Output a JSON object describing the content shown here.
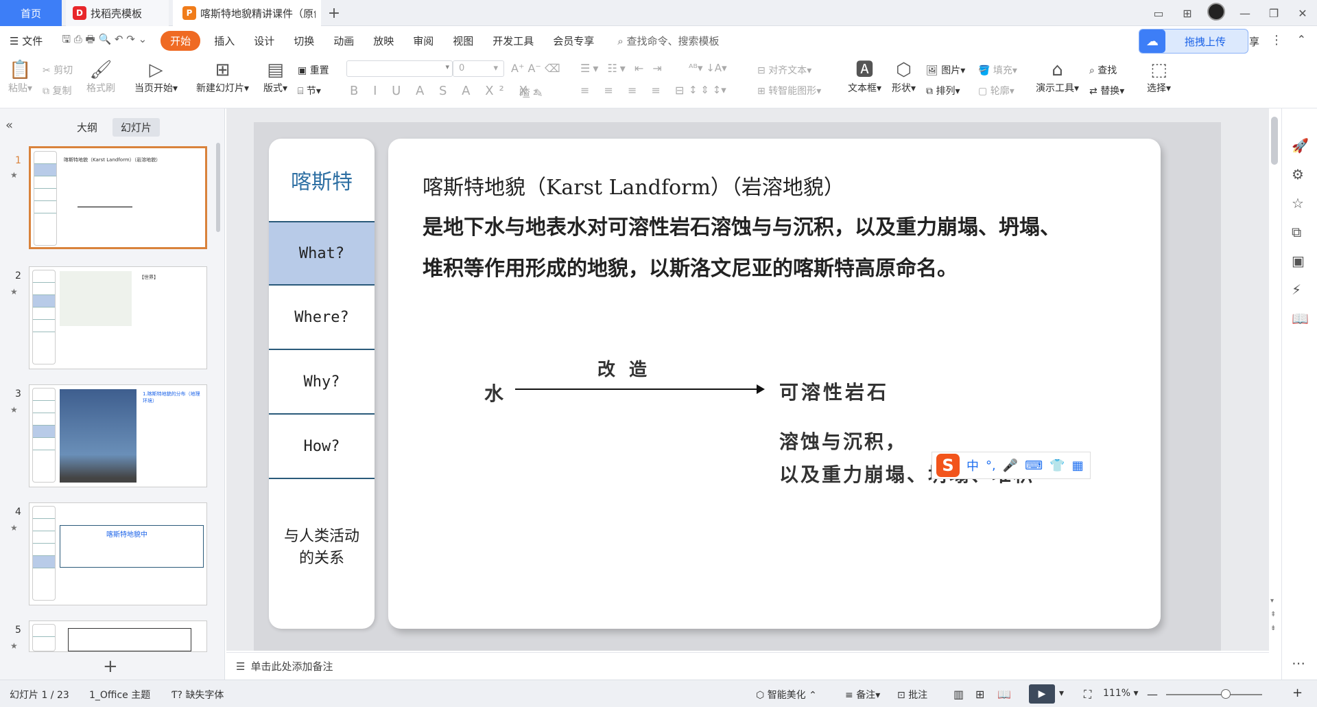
{
  "tabs": {
    "home": "首页",
    "daoke": "找稻壳模板",
    "document": "喀斯特地貌精讲课件（原创"
  },
  "menu": {
    "file": "文件",
    "items": [
      "开始",
      "插入",
      "设计",
      "切换",
      "动画",
      "放映",
      "审阅",
      "视图",
      "开发工具",
      "会员专享"
    ],
    "search": "查找命令、搜索模板",
    "upload": "拖拽上传",
    "share_suffix": "享"
  },
  "ribbon": {
    "paste": "粘贴",
    "cut": "剪切",
    "copy": "复制",
    "format_painter": "格式刷",
    "from_current": "当页开始",
    "new_slide": "新建幻灯片",
    "layout": "版式",
    "reset": "重置",
    "section": "节",
    "font_size": "0",
    "align_text": "对齐文本",
    "convert_smartart": "转智能图形",
    "textbox": "文本框",
    "shape": "形状",
    "picture": "图片",
    "arrange": "排列",
    "fill": "填充",
    "outline": "轮廓",
    "present_tools": "演示工具",
    "find": "查找",
    "replace": "替换",
    "select": "选择"
  },
  "leftpanel": {
    "tab_outline": "大纲",
    "tab_slides": "幻灯片",
    "thumbs": [
      {
        "num": "1",
        "title": "喀斯特地貌（Karst Landform）（岩溶地貌）"
      },
      {
        "num": "2",
        "title": "【世界】"
      },
      {
        "num": "3",
        "title": "1.喀斯特地貌的分布（地理环境）"
      },
      {
        "num": "4",
        "title": "喀斯特地貌中"
      },
      {
        "num": "5",
        "title": ""
      }
    ]
  },
  "slide": {
    "nav_title": "喀斯特",
    "nav_items": [
      "What?",
      "Where?",
      "Why?",
      "How?"
    ],
    "nav_last": "与人类活动的关系",
    "heading": "喀斯特地貌（Karst Landform）（岩溶地貌）",
    "para1": "是地下水与地表水对可溶性岩石溶蚀与与沉积，以及重力崩塌、坍塌、",
    "para2": "堆积等作用形成的地貌，以斯洛文尼亚的喀斯特高原命名。",
    "diagram": {
      "source": "水",
      "action": "改造",
      "target": "可溶性岩石",
      "line1": "溶蚀与沉积，",
      "line2": "以及重力崩塌、坍塌、堆积"
    },
    "ime": {
      "mode": "中",
      "punct": "°,"
    }
  },
  "notes": {
    "placeholder": "单击此处添加备注"
  },
  "status": {
    "slide_info": "幻灯片 1 / 23",
    "theme": "1_Office 主题",
    "missing_font": "缺失字体",
    "beautify": "智能美化",
    "notes": "备注",
    "comments": "批注",
    "zoom": "111%"
  }
}
